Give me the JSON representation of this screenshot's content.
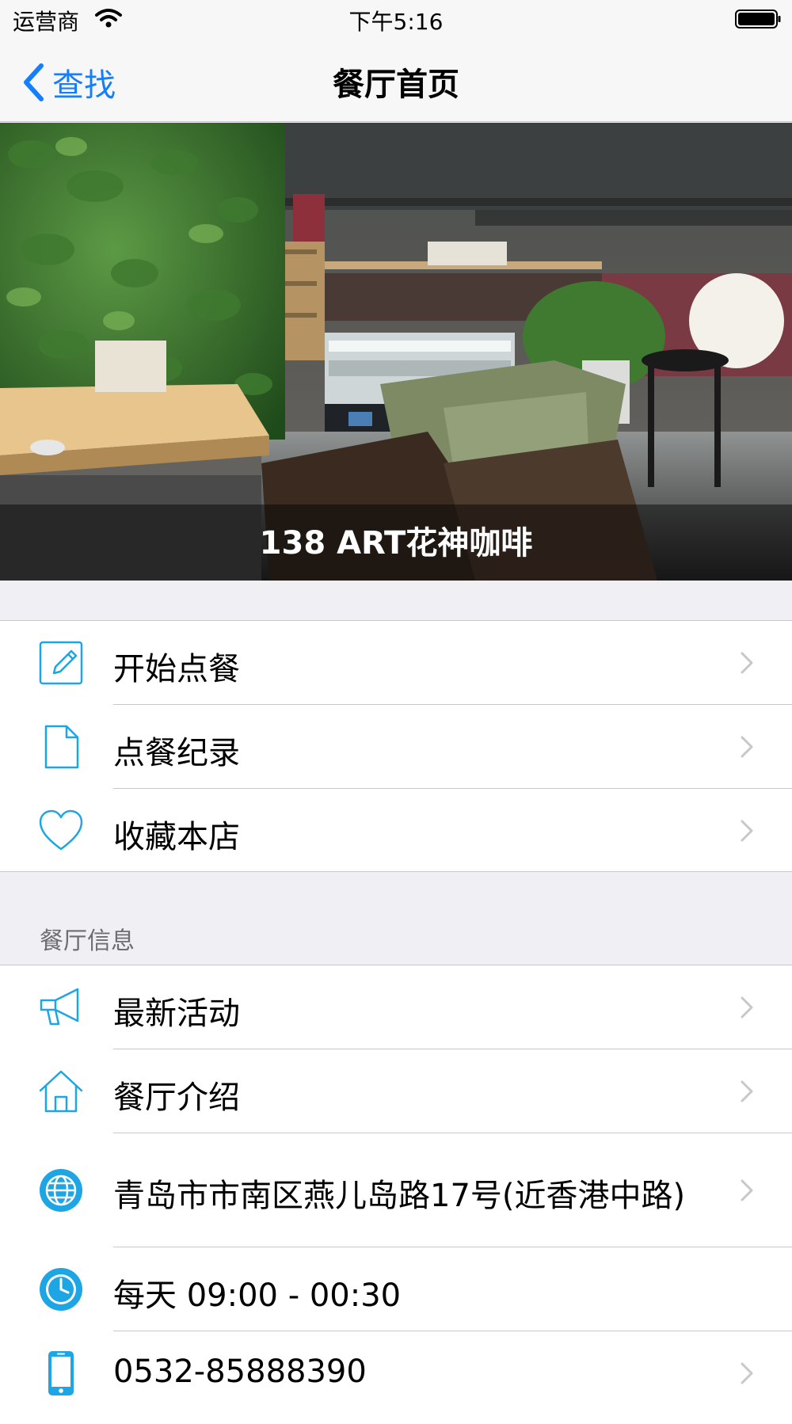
{
  "status_bar": {
    "carrier": "运营商",
    "time": "下午5:16"
  },
  "nav": {
    "back_label": "查找",
    "title": "餐厅首页"
  },
  "hero": {
    "restaurant_name": "138 ART花神咖啡"
  },
  "actions": [
    {
      "label": "开始点餐",
      "icon": "pencil-edit-icon"
    },
    {
      "label": "点餐纪录",
      "icon": "document-icon"
    },
    {
      "label": "收藏本店",
      "icon": "heart-icon"
    }
  ],
  "info": {
    "header": "餐厅信息",
    "activity_label": "最新活动",
    "intro_label": "餐厅介绍",
    "address": "青岛市市南区燕儿岛路17号(近香港中路)",
    "hours": "每天 09:00 - 00:30",
    "phone": "0532-85888390"
  },
  "colors": {
    "accent": "#1ea5e3",
    "link": "#157efb",
    "chevron": "#c7c7cc",
    "separator": "#c8c7cc",
    "background": "#efeff4"
  }
}
